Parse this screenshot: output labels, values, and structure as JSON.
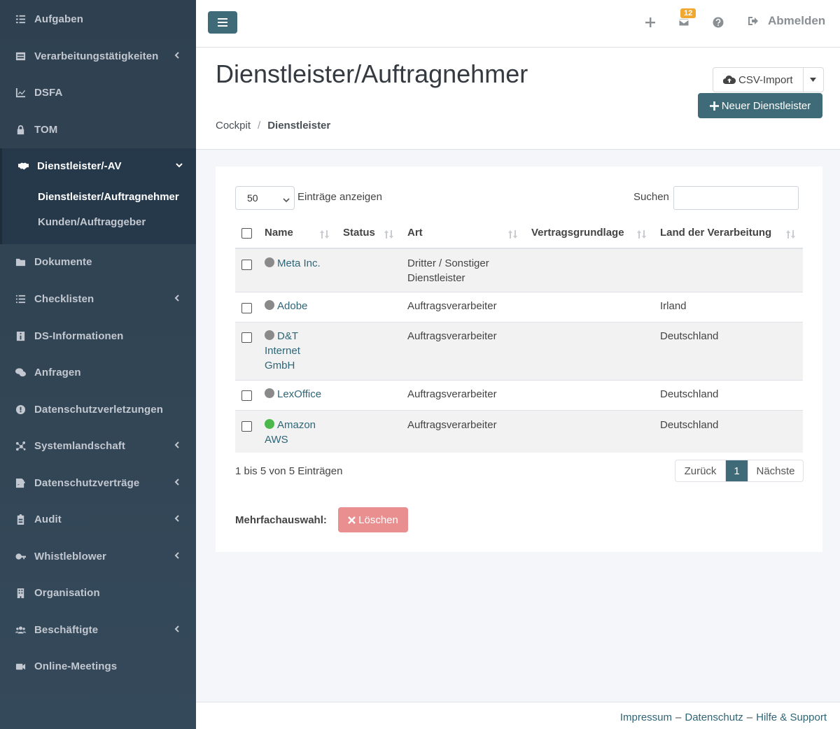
{
  "sidebar": {
    "items": [
      {
        "label": "Aufgaben",
        "icon": "list-check-icon"
      },
      {
        "label": "Verarbeitungstätigkeiten",
        "icon": "table-list-icon"
      },
      {
        "label": "DSFA",
        "icon": "chart-line-icon"
      },
      {
        "label": "TOM",
        "icon": "lock-icon"
      },
      {
        "label": "Dokumente",
        "icon": "folder-icon"
      },
      {
        "label": "Checklisten",
        "icon": "list-icon"
      },
      {
        "label": "DS-Informationen",
        "icon": "info-icon"
      },
      {
        "label": "Anfragen",
        "icon": "comments-icon"
      },
      {
        "label": "Datenschutzverletzungen",
        "icon": "exclamation-circle-icon"
      },
      {
        "label": "Systemlandschaft",
        "icon": "network-icon"
      },
      {
        "label": "Datenschutzverträge",
        "icon": "signature-icon"
      },
      {
        "label": "Audit",
        "icon": "clipboard-icon"
      },
      {
        "label": "Whistleblower",
        "icon": "key-icon"
      },
      {
        "label": "Organisation",
        "icon": "building-icon"
      },
      {
        "label": "Beschäftigte",
        "icon": "users-icon"
      },
      {
        "label": "Online-Meetings",
        "icon": "video-icon"
      }
    ],
    "active_group": {
      "label": "Dienstleister/-AV",
      "icon": "handshake-icon",
      "children": [
        {
          "label": "Dienstleister/Auftragnehmer"
        },
        {
          "label": "Kunden/Auftraggeber"
        }
      ]
    }
  },
  "topbar": {
    "notification_count": "12",
    "logout_label": "Abmelden"
  },
  "header": {
    "title": "Dienstleister/Auftragnehmer",
    "breadcrumb": {
      "root": "Cockpit",
      "separator": "/",
      "current": "Dienstleister"
    },
    "csv_import_label": "CSV-Import",
    "new_button_label": "Neuer Dienstleister"
  },
  "table_controls": {
    "page_length": "50",
    "page_length_label": "Einträge anzeigen",
    "search_label": "Suchen",
    "search_value": ""
  },
  "table": {
    "columns": [
      "Name",
      "Status",
      "Art",
      "Vertragsgrundlage",
      "Land der Verarbeitung"
    ],
    "rows": [
      {
        "name": "Meta Inc.",
        "status_color": "#8a8a8a",
        "status": "",
        "art": "Dritter / Sonstiger Dienstleister",
        "vertragsgrundlage": "",
        "land": ""
      },
      {
        "name": "Adobe",
        "status_color": "#8a8a8a",
        "status": "",
        "art": "Auftragsverarbeiter",
        "vertragsgrundlage": "",
        "land": "Irland"
      },
      {
        "name": "D&T Internet GmbH",
        "status_color": "#8a8a8a",
        "status": "",
        "art": "Auftragsverarbeiter",
        "vertragsgrundlage": "",
        "land": "Deutschland"
      },
      {
        "name": "LexOffice",
        "status_color": "#8a8a8a",
        "status": "",
        "art": "Auftragsverarbeiter",
        "vertragsgrundlage": "",
        "land": "Deutschland"
      },
      {
        "name": "Amazon AWS",
        "status_color": "#4cb84c",
        "status": "",
        "art": "Auftragsverarbeiter",
        "vertragsgrundlage": "",
        "land": "Deutschland"
      }
    ]
  },
  "pagination": {
    "info": "1 bis 5 von 5 Einträgen",
    "prev_label": "Zurück",
    "current_page": "1",
    "next_label": "Nächste"
  },
  "bulk": {
    "label": "Mehrfachauswahl:",
    "delete_label": "Löschen"
  },
  "footer": {
    "impressum": "Impressum",
    "datenschutz": "Datenschutz",
    "hilfe": "Hilfe & Support",
    "separator": "–"
  },
  "colors": {
    "accent": "#3f6a78",
    "sidebar_bg": "#2f4150",
    "danger_light": "#ea8f8f",
    "badge": "#f0a830",
    "link": "#2e6577"
  }
}
